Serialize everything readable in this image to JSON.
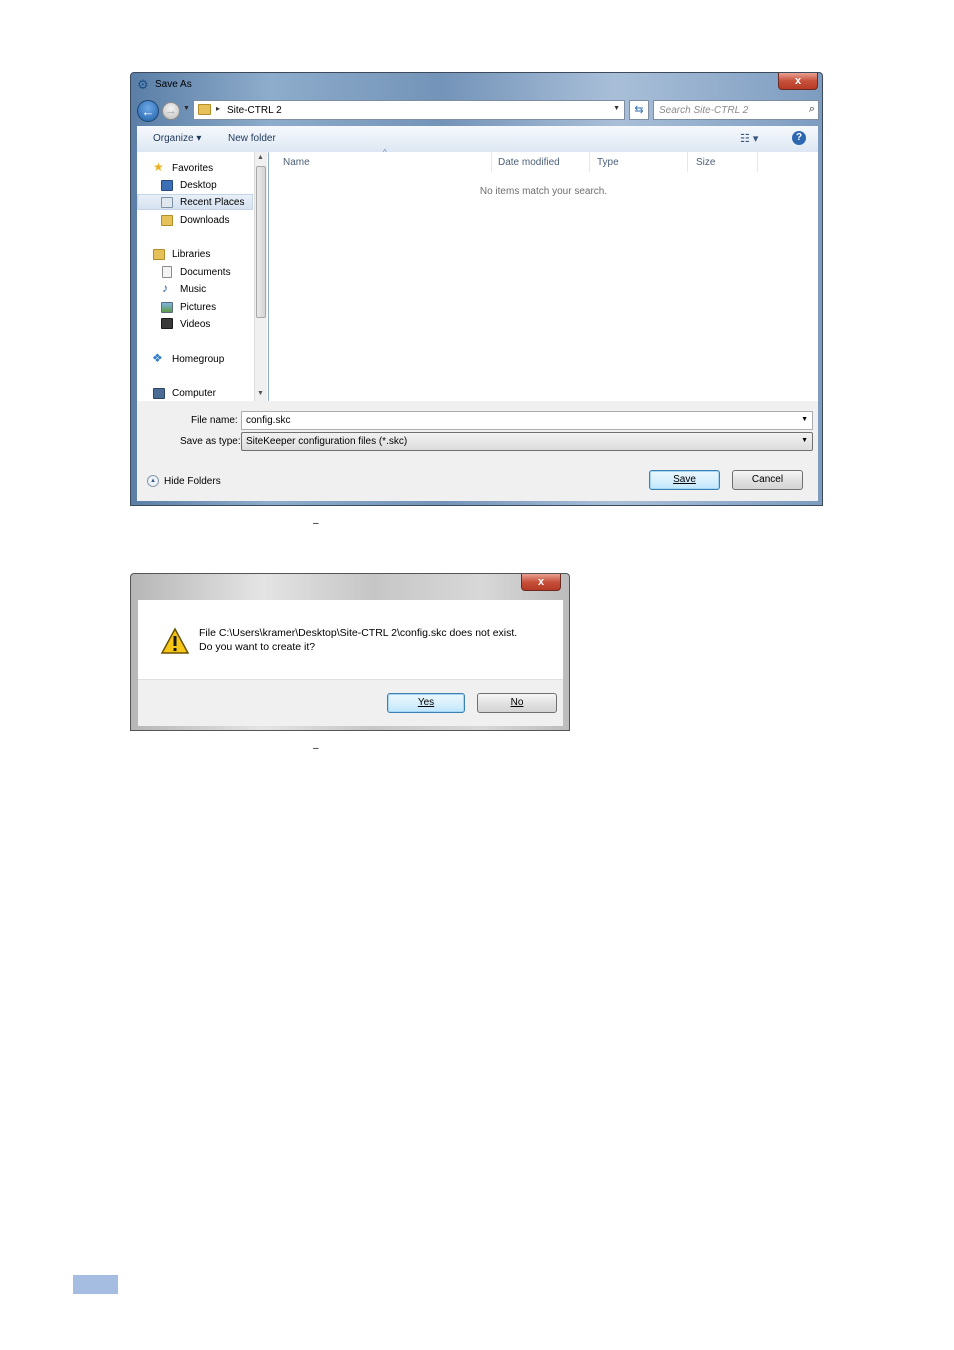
{
  "save_dialog": {
    "title": "Save As",
    "close_glyph": "x",
    "back_glyph": "←",
    "forward_glyph": "→",
    "history_glyph": "▼",
    "breadcrumb_arrow": "▸",
    "breadcrumb": "Site-CTRL 2",
    "address_dropdown_glyph": "▼",
    "refresh_glyph": "⇆",
    "search_placeholder": "Search Site-CTRL 2",
    "search_glyph": "⌕",
    "toolbar": {
      "organize": "Organize ▾",
      "new_folder": "New folder",
      "views_glyph": "☷ ▾",
      "help_glyph": "?"
    },
    "nav": {
      "favorites_header": "Favorites",
      "favorites": [
        "Desktop",
        "Recent Places",
        "Downloads"
      ],
      "libraries_header": "Libraries",
      "libraries": [
        "Documents",
        "Music",
        "Pictures",
        "Videos"
      ],
      "homegroup": "Homegroup",
      "computer": "Computer",
      "scroll_up": "▲",
      "scroll_down": "▼"
    },
    "columns": [
      "Name",
      "Date modified",
      "Type",
      "Size"
    ],
    "sort_glyph": "^",
    "empty_message": "No items match your search.",
    "file_name_label": "File name:",
    "file_name_value": "config.skc",
    "save_type_label": "Save as type:",
    "save_type_value": "SiteKeeper configuration files (*.skc)",
    "dropdown_glyph": "▼",
    "hide_folders": "Hide Folders",
    "hide_folders_glyph": "▲",
    "save_button": "Save",
    "cancel_button": "Cancel"
  },
  "caption_marks": [
    "–",
    "–"
  ],
  "message_dialog": {
    "close_glyph": "x",
    "line1": "File C:\\Users\\kramer\\Desktop\\Site-CTRL 2\\config.skc does not exist.",
    "line2": "Do you want to create it?",
    "warning_glyph": "!",
    "yes_button": "Yes",
    "no_button": "No"
  },
  "colors": {
    "accent_blue": "#2d67b1",
    "close_red": "#c7503b",
    "page_tab": "#a4bde0",
    "warning_yellow": "#f5c518"
  }
}
